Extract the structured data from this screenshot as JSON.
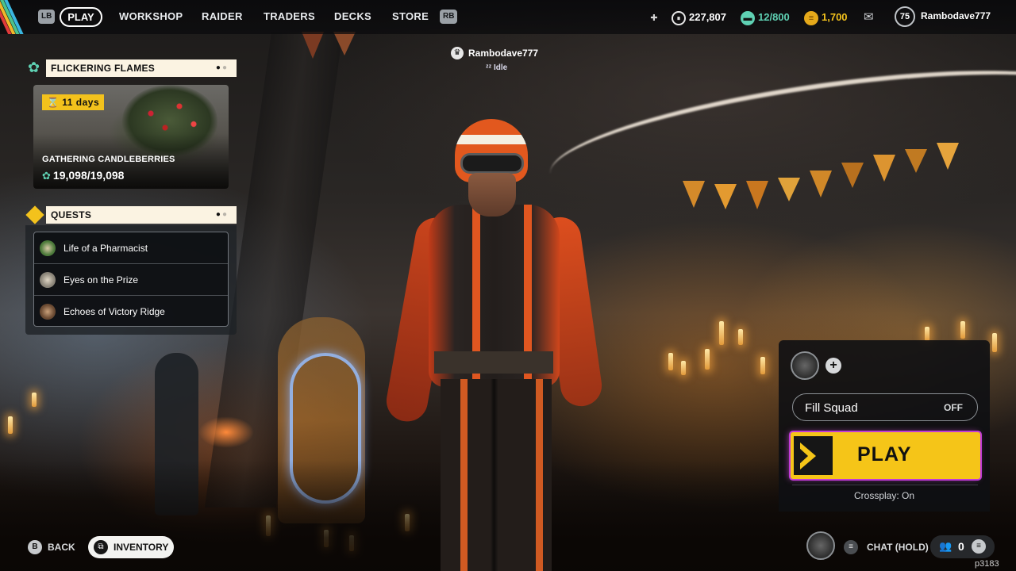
{
  "topbar": {
    "left_bumper": "LB",
    "right_bumper": "RB",
    "nav": [
      {
        "label": "PLAY"
      },
      {
        "label": "WORKSHOP"
      },
      {
        "label": "RAIDER"
      },
      {
        "label": "TRADERS"
      },
      {
        "label": "DECKS"
      },
      {
        "label": "STORE"
      }
    ],
    "coins": "227,807",
    "capacity": "12/800",
    "tokens": "1,700",
    "level": "75",
    "username": "Rambodave777"
  },
  "player_tag": {
    "name": "Rambodave777",
    "status": "Idle"
  },
  "event": {
    "header": "FLICKERING FLAMES",
    "timer": "11 days",
    "title": "GATHERING CANDLEBERRIES",
    "progress": "19,098/19,098"
  },
  "quests": {
    "header": "QUESTS",
    "items": [
      {
        "label": "Life of a Pharmacist"
      },
      {
        "label": "Eyes on the Prize"
      },
      {
        "label": "Echoes of Victory Ridge"
      }
    ]
  },
  "squad": {
    "fill_label": "Fill Squad",
    "fill_value": "OFF",
    "play_label": "PLAY",
    "crossplay": "Crossplay: On"
  },
  "bottombar": {
    "back_key": "B",
    "back_label": "BACK",
    "inventory_label": "INVENTORY",
    "chat_label": "CHAT (HOLD)",
    "friends_count": "0",
    "build": "p3183"
  },
  "colors": {
    "accent_yellow": "#f5c518",
    "panel_header": "#fbf3e2",
    "event_icon": "#5fd1b3",
    "play_glow": "#c03ad8"
  }
}
